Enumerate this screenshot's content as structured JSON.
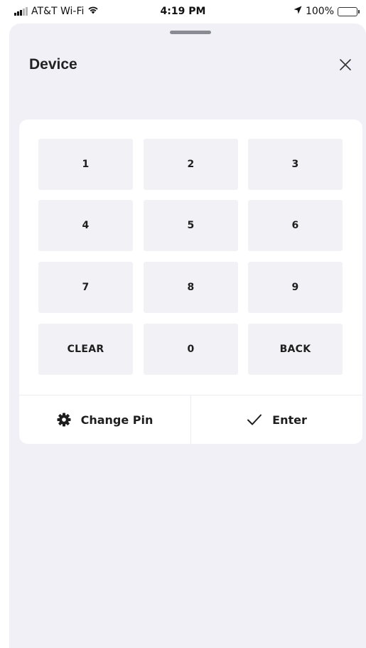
{
  "status_bar": {
    "carrier": "AT&T Wi-Fi",
    "time": "4:19 PM",
    "battery": "100%",
    "icons": [
      "signal-icon",
      "wifi-icon",
      "location-arrow-icon",
      "battery-icon"
    ]
  },
  "sheet": {
    "title": "Device",
    "close_icon": "close-icon"
  },
  "keypad": {
    "keys": [
      "1",
      "2",
      "3",
      "4",
      "5",
      "6",
      "7",
      "8",
      "9",
      "CLEAR",
      "0",
      "BACK"
    ]
  },
  "actions": {
    "change_pin": {
      "label": "Change Pin",
      "icon": "gear-icon"
    },
    "enter": {
      "label": "Enter",
      "icon": "checkmark-icon"
    }
  },
  "colors": {
    "sheet_background": "#f0f0f6",
    "card_background": "#ffffff",
    "key_background": "#f1f1f6",
    "text": "#1e1e1e"
  }
}
